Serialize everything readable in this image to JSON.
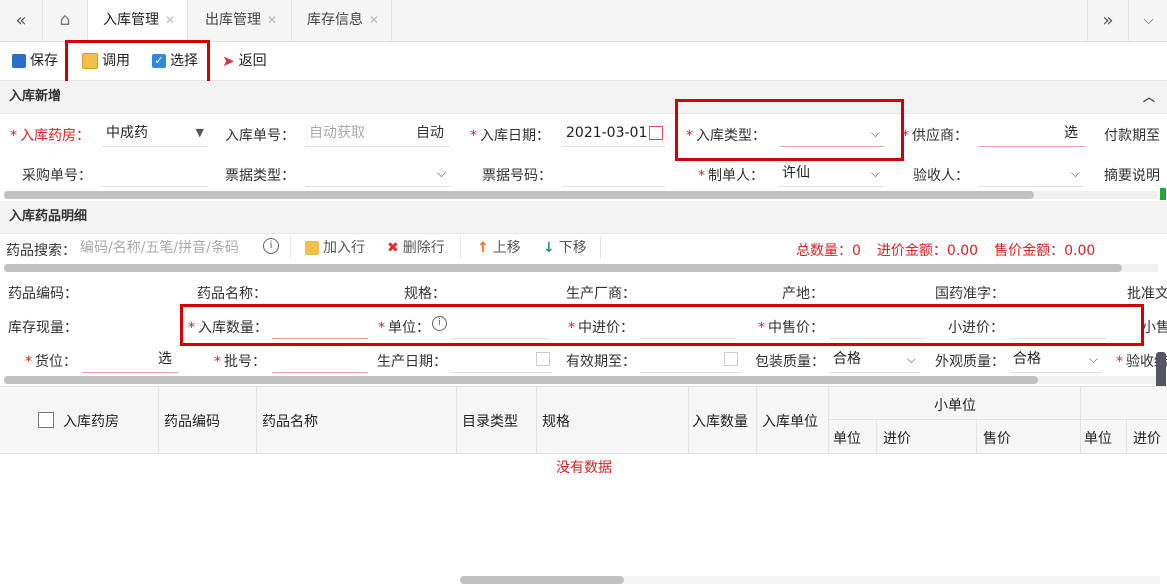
{
  "tabs": [
    {
      "label": "入库管理"
    },
    {
      "label": "出库管理"
    },
    {
      "label": "库存信息"
    }
  ],
  "toolbar": {
    "save": "保存",
    "transfer": "调用",
    "select": "选择",
    "back": "返回"
  },
  "section1": {
    "title": "入库新增"
  },
  "form": {
    "pharmacy_label": "入库药房：",
    "pharmacy_value": "中成药",
    "order_no_label": "入库单号：",
    "order_no_placeholder": "自动获取",
    "order_no_btn": "自动",
    "date_label": "入库日期：",
    "date_value": "2021-03-01",
    "type_label": "入库类型：",
    "supplier_label": "供应商：",
    "supplier_btn": "选",
    "pay_label": "付款期至",
    "purchase_label": "采购单号：",
    "bill_type_label": "票据类型：",
    "bill_no_label": "票据号码：",
    "maker_label": "制单人：",
    "maker_value": "许仙",
    "checker_label": "验收人：",
    "summary_label": "摘要说明"
  },
  "section2": {
    "title": "入库药品明细"
  },
  "detail": {
    "search_label": "药品搜索：",
    "search_placeholder": "编码/名称/五笔/拼音/条码",
    "add_row": "加入行",
    "del_row": "删除行",
    "up": "上移",
    "down": "下移",
    "total_qty_label": "总数量：",
    "total_qty": "0",
    "cost_label": "进价金额：",
    "cost": "0.00",
    "sale_label": "售价金额：",
    "sale": "0.00",
    "row1": [
      "药品编码：",
      "药品名称：",
      "规格：",
      "生产厂商：",
      "产地：",
      "国药准字：",
      "批准文"
    ],
    "stock_label": "库存现量：",
    "in_qty_label": "入库数量：",
    "unit_label": "单位：",
    "mid_cost_label": "中进价：",
    "mid_sale_label": "中售价：",
    "small_cost_label": "小进价：",
    "small_sale_label": "小售",
    "slot_label": "货位：",
    "slot_btn": "选",
    "batch_label": "批号：",
    "prod_date_label": "生产日期：",
    "expire_label": "有效期至：",
    "pack_label": "包装质量：",
    "pack_value": "合格",
    "look_label": "外观质量：",
    "look_value": "合格",
    "accept_label": "验收结"
  },
  "table": {
    "headers": [
      "入库药房",
      "药品编码",
      "药品名称",
      "目录类型",
      "规格",
      "入库数量",
      "入库单位"
    ],
    "group": "小单位",
    "sub": [
      "单位",
      "进价",
      "售价",
      "单位",
      "进价"
    ],
    "empty": "没有数据"
  }
}
